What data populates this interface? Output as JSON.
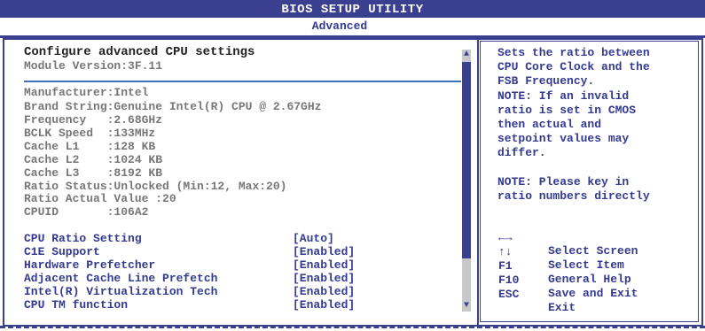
{
  "window": {
    "title": "BIOS SETUP UTILITY"
  },
  "tabs": {
    "active": "Advanced"
  },
  "section": {
    "title": "Configure advanced CPU settings",
    "module_version": "Module Version:3F.11"
  },
  "cpu_info": [
    "Manufacturer:Intel",
    "Brand String:Genuine Intel(R) CPU @ 2.67GHz",
    "Frequency   :2.68GHz",
    "BCLK Speed  :133MHz",
    "Cache L1    :128 KB",
    "Cache L2    :1024 KB",
    "Cache L3    :8192 KB",
    "Ratio Status:Unlocked (Min:12, Max:20)",
    "Ratio Actual Value :20",
    "CPUID       :106A2"
  ],
  "settings": [
    {
      "label": "CPU Ratio Setting",
      "value": "[Auto]"
    },
    {
      "label": "C1E Support",
      "value": "[Enabled]"
    },
    {
      "label": "Hardware Prefetcher",
      "value": "[Enabled]"
    },
    {
      "label": "Adjacent Cache Line Prefetch",
      "value": "[Enabled]"
    },
    {
      "label": "Intel(R) Virtualization Tech",
      "value": "[Enabled]"
    },
    {
      "label": "CPU TM function",
      "value": "[Enabled]"
    }
  ],
  "help": {
    "text": "Sets the ratio between\nCPU Core Clock and the\nFSB Frequency.\nNOTE: If an invalid\nratio is set in CMOS\nthen actual and\nsetpoint values may\ndiffer.\n\nNOTE: Please key in\nratio numbers directly"
  },
  "keys": [
    {
      "key": "←→",
      "desc": "Select Screen"
    },
    {
      "key": "↑↓",
      "desc": "Select Item"
    },
    {
      "key": "F1",
      "desc": "General Help"
    },
    {
      "key": "F10",
      "desc": "Save and Exit"
    },
    {
      "key": "ESC",
      "desc": "Exit"
    }
  ],
  "colors": {
    "frame": "#3a3f8f",
    "text_active": "#333a90",
    "text_static": "#777777",
    "separator": "#3a72b9"
  }
}
